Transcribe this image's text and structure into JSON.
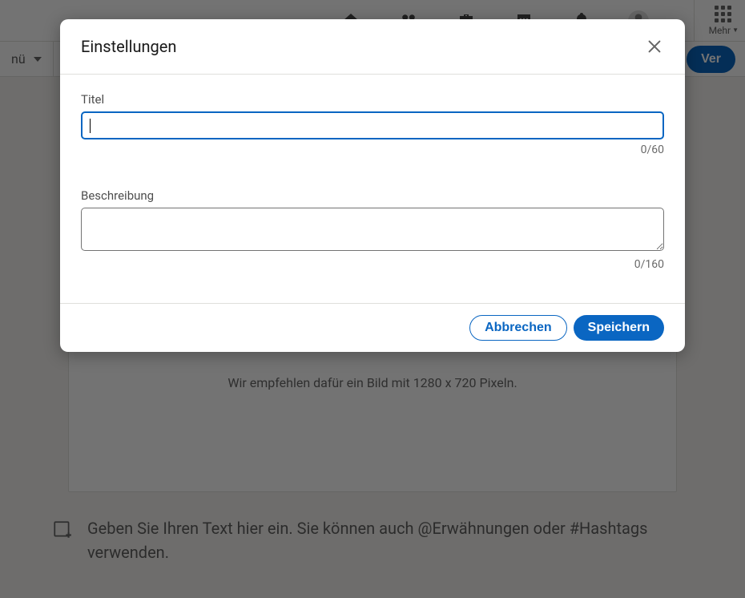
{
  "topnav": {
    "more_label": "Mehr"
  },
  "secondary": {
    "menu_label": "nü",
    "publish_button": "Ver"
  },
  "editor": {
    "image_hint": "Wir empfehlen dafür ein Bild mit 1280 x 720 Pixeln.",
    "placeholder_text": "Geben Sie Ihren Text hier ein. Sie können auch @Erwähnungen oder #Hashtags verwenden."
  },
  "modal": {
    "title": "Einstellungen",
    "title_field_label": "Titel",
    "title_value": "",
    "title_count": "0/60",
    "description_label": "Beschreibung",
    "description_value": "",
    "description_count": "0/160",
    "cancel": "Abbrechen",
    "save": "Speichern"
  }
}
